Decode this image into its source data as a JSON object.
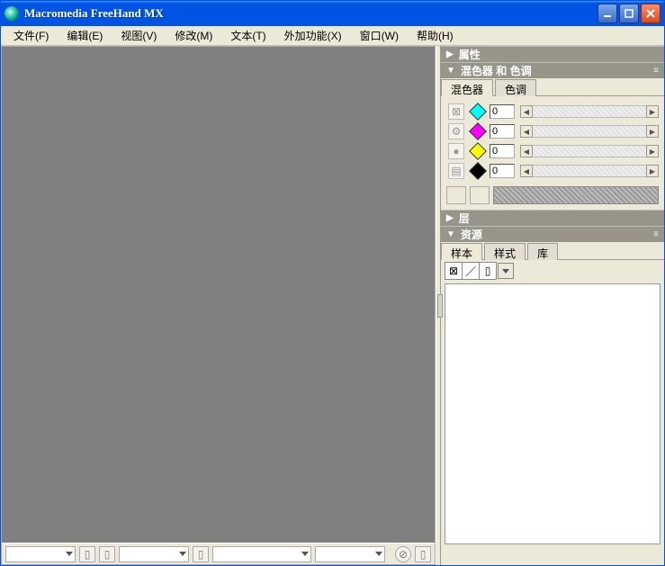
{
  "title": "Macromedia FreeHand MX",
  "menu": {
    "file": "文件(F)",
    "edit": "编辑(E)",
    "view": "视图(V)",
    "modify": "修改(M)",
    "text": "文本(T)",
    "xtras": "外加功能(X)",
    "window": "窗口(W)",
    "help": "帮助(H)"
  },
  "panels": {
    "properties": {
      "title": "属性"
    },
    "mixerTint": {
      "title": "混色器 和 色调",
      "tabs": {
        "mixer": "混色器",
        "tint": "色调"
      },
      "values": {
        "c": "0",
        "m": "0",
        "y": "0",
        "k": "0"
      }
    },
    "layers": {
      "title": "层"
    },
    "resources": {
      "title": "资源",
      "tabs": {
        "swatches": "样本",
        "styles": "样式",
        "library": "库"
      }
    }
  }
}
